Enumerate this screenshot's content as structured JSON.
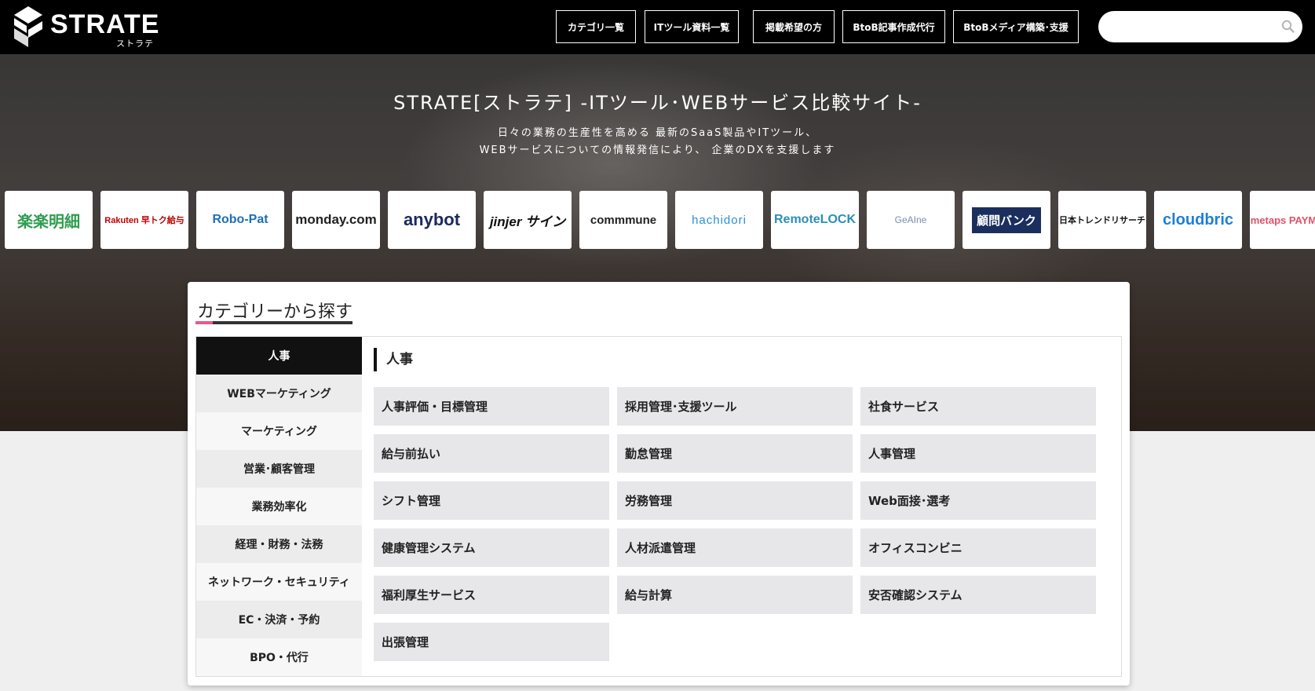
{
  "header": {
    "logo_text": "STRATE",
    "logo_sub": "ストラテ",
    "nav": [
      {
        "label": "カテゴリ一覧"
      },
      {
        "label": "ITツール資料一覧"
      },
      {
        "label": "掲載希望の方"
      },
      {
        "label": "BtoB記事作成代行"
      },
      {
        "label": "BtoBメディア構築･支援"
      }
    ],
    "search": {
      "value": "",
      "icon": "search-icon"
    }
  },
  "hero": {
    "title": "STRATE[ストラテ] -ITツール･WEBサービス比較サイト-",
    "desc_line1": "日々の業務の生産性を高める 最新のSaaS製品やITツール、",
    "desc_line2": "WEBサービスについての情報発信により、 企業のDXを支援します",
    "logos": [
      {
        "text": "楽楽明細",
        "color": "#2f9d4f"
      },
      {
        "text": "Rakuten 早トク給与",
        "color": "#bf0000"
      },
      {
        "text": "Robo-Pat",
        "color": "#1d6fb8"
      },
      {
        "text": "monday.com",
        "color": "#222222"
      },
      {
        "text": "anybot",
        "color": "#1b2a5c"
      },
      {
        "text": "jinjer サイン",
        "color": "#111111"
      },
      {
        "text": "commmune",
        "color": "#222222"
      },
      {
        "text": "hachidori",
        "color": "#2b8fd6"
      },
      {
        "text": "RemoteLOCK",
        "color": "#2a8fb8"
      },
      {
        "text": "GeAIne",
        "color": "#7a8ea8"
      },
      {
        "text": "顧問バンク",
        "color": "#1a2f5e"
      },
      {
        "text": "日本トレンドリサーチ",
        "color": "#111111"
      },
      {
        "text": "cloudbric",
        "color": "#1e7fd6"
      },
      {
        "text": "metaps PAYMENT",
        "color": "#e0506a"
      }
    ]
  },
  "categories": {
    "title": "カテゴリーから探す",
    "side": [
      {
        "label": "人事",
        "active": true
      },
      {
        "label": "WEBマーケティング"
      },
      {
        "label": "マーケティング"
      },
      {
        "label": "営業･顧客管理"
      },
      {
        "label": "業務効率化"
      },
      {
        "label": "経理・財務・法務"
      },
      {
        "label": "ネットワーク・セキュリティ"
      },
      {
        "label": "EC・決済・予約"
      },
      {
        "label": "BPO・代行"
      }
    ],
    "active_heading": "人事",
    "items": [
      {
        "label": "人事評価・目標管理"
      },
      {
        "label": "採用管理･支援ツール"
      },
      {
        "label": "社食サービス"
      },
      {
        "label": "給与前払い"
      },
      {
        "label": "勤怠管理"
      },
      {
        "label": "人事管理"
      },
      {
        "label": "シフト管理"
      },
      {
        "label": "労務管理"
      },
      {
        "label": "Web面接･選考"
      },
      {
        "label": "健康管理システム"
      },
      {
        "label": "人材派遣管理"
      },
      {
        "label": "オフィスコンビニ"
      },
      {
        "label": "福利厚生サービス"
      },
      {
        "label": "給与計算"
      },
      {
        "label": "安否確認システム"
      },
      {
        "label": "出張管理"
      }
    ]
  }
}
